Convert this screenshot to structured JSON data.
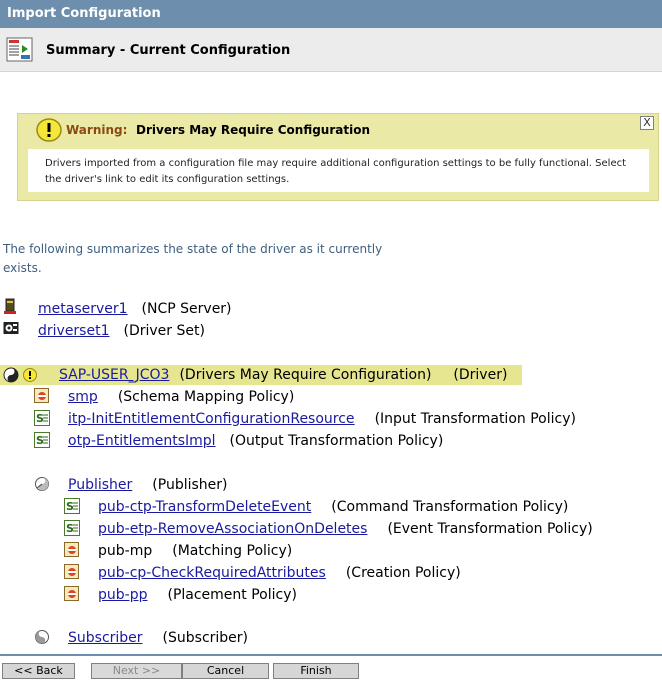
{
  "window": {
    "title": "Import Configuration"
  },
  "header": {
    "title": "Summary - Current Configuration",
    "icon": "summary-icon"
  },
  "warning": {
    "label": "Warning:",
    "title": "Drivers May Require Configuration",
    "close": "X",
    "body_line1": "Drivers imported from a configuration file may require additional configuration settings to be fully functional. Select",
    "body_line2": "the driver's link to edit its configuration settings."
  },
  "intro": {
    "line1": "The following summarizes the state of the driver as it currently",
    "line2": "exists."
  },
  "tree": {
    "server": {
      "name": "metaserver1",
      "type": "(NCP Server)",
      "icon": "server-icon"
    },
    "driverset": {
      "name": "driverset1",
      "type": "(Driver Set)",
      "icon": "driverset-icon"
    },
    "driver": {
      "name": "SAP-USER_JCO3",
      "status": "(Drivers May Require Configuration)",
      "type": "(Driver)",
      "icon": "driver-icon"
    },
    "driver_items": [
      {
        "name": "smp",
        "type": "(Schema Mapping Policy)",
        "icon": "policy-icon"
      },
      {
        "name": "itp-InitEntitlementConfigurationResource",
        "type": "(Input Transformation Policy)",
        "icon": "stylesheet-icon"
      },
      {
        "name": "otp-EntitlementsImpl",
        "type": "(Output Transformation Policy)",
        "icon": "stylesheet-icon"
      }
    ],
    "publisher": {
      "name": "Publisher",
      "type": "(Publisher)",
      "icon": "publisher-icon"
    },
    "publisher_items": [
      {
        "name": "pub-ctp-TransformDeleteEvent",
        "type": "(Command Transformation Policy)",
        "icon": "stylesheet-icon"
      },
      {
        "name": "pub-etp-RemoveAssociationOnDeletes",
        "type": "(Event Transformation Policy)",
        "icon": "stylesheet-icon"
      },
      {
        "name": "pub-mp",
        "type": "(Matching Policy)",
        "icon": "policy-icon"
      },
      {
        "name": "pub-cp-CheckRequiredAttributes",
        "type": "(Creation Policy)",
        "icon": "policy-icon"
      },
      {
        "name": "pub-pp",
        "type": "(Placement Policy)",
        "icon": "policy-icon"
      }
    ],
    "subscriber": {
      "name": "Subscriber",
      "type": "(Subscriber)",
      "icon": "subscriber-icon"
    }
  },
  "buttons": {
    "back": "<< Back",
    "next": "Next >>",
    "cancel": "Cancel",
    "finish": "Finish"
  },
  "colors": {
    "title_bar": "#6d8fad",
    "warning_bg": "#ebe9a6",
    "highlight": "#e7e690",
    "link": "#1a1aa0"
  }
}
